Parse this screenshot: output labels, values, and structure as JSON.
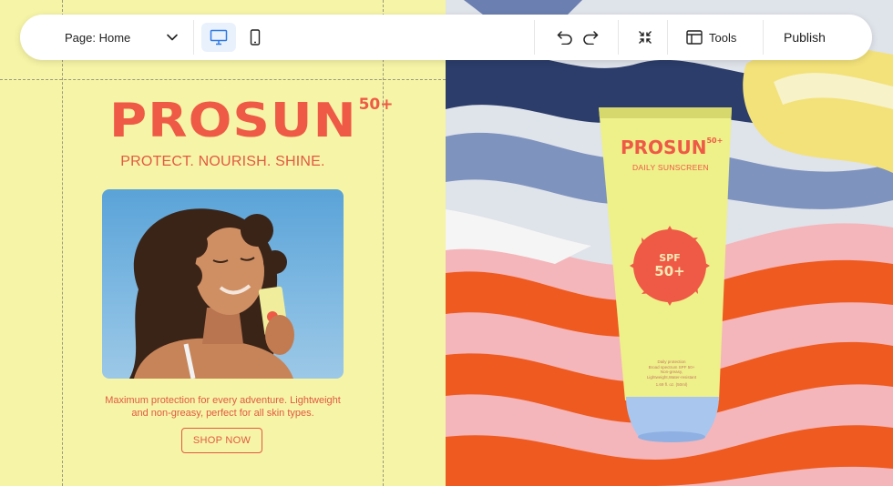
{
  "toolbar": {
    "page_label": "Page: Home",
    "tools_label": "Tools",
    "publish_label": "Publish",
    "icons": [
      "chevron-down-icon",
      "desktop-icon",
      "mobile-icon",
      "undo-icon",
      "redo-icon",
      "collapse-icon",
      "tools-icon"
    ]
  },
  "canvas": {
    "brand_name": "PROSUN",
    "brand_superscript": "50+",
    "tagline": "PROTECT. NOURISH. SHINE.",
    "description": "Maximum protection for every adventure. Lightweight and non-greasy, perfect for all skin types.",
    "cta_label": "SHOP NOW"
  },
  "product": {
    "brand_name": "PROSUN",
    "brand_superscript": "50+",
    "subtitle": "DAILY SUNSCREEN",
    "badge_line1": "SPF",
    "badge_line2": "50+",
    "fine_print_1": "Daily protection",
    "fine_print_2": "Broad spectrum SPF 50+",
    "fine_print_3": "Non-greasy,",
    "fine_print_4": "Lightweight,Water-resistant",
    "fine_print_5": "1.69 fl. oz. (50ml)"
  },
  "colors": {
    "page_bg": "#f6f4a6",
    "brand": "#ee5a45",
    "accent_blue": "#2f7ae5",
    "tube": "#eef08a",
    "cap": "#a9c6ef"
  }
}
